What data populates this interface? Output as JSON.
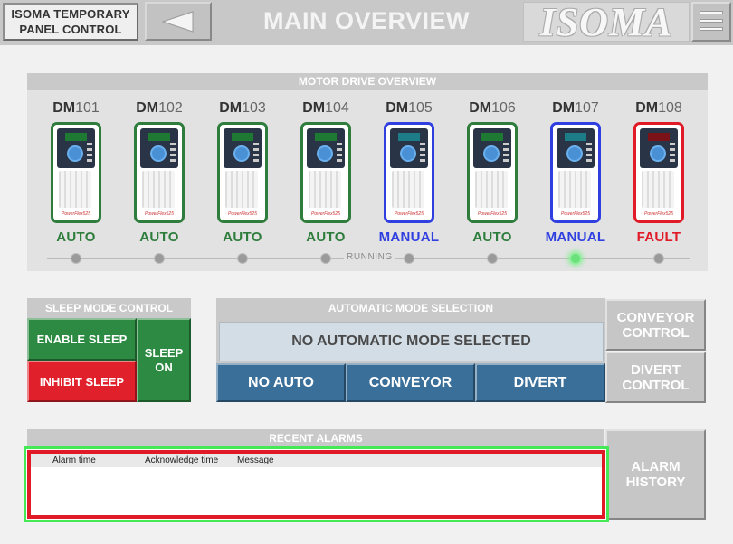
{
  "header": {
    "brand_line1": "ISOMA TEMPORARY",
    "brand_line2": "PANEL CONTROL",
    "title": "MAIN OVERVIEW",
    "logo_text": "ISOMA",
    "back_icon": "left-triangle-icon",
    "menu_icon": "hamburger-menu-icon"
  },
  "motor_panel": {
    "title": "MOTOR DRIVE OVERVIEW",
    "running_label": "RUNNING",
    "drives": [
      {
        "prefix": "DM",
        "num": "101",
        "status": "AUTO",
        "state": "auto",
        "running": false
      },
      {
        "prefix": "DM",
        "num": "102",
        "status": "AUTO",
        "state": "auto",
        "running": false
      },
      {
        "prefix": "DM",
        "num": "103",
        "status": "AUTO",
        "state": "auto",
        "running": false
      },
      {
        "prefix": "DM",
        "num": "104",
        "status": "AUTO",
        "state": "auto",
        "running": false
      },
      {
        "prefix": "DM",
        "num": "105",
        "status": "MANUAL",
        "state": "manual",
        "running": false
      },
      {
        "prefix": "DM",
        "num": "106",
        "status": "AUTO",
        "state": "auto",
        "running": false
      },
      {
        "prefix": "DM",
        "num": "107",
        "status": "MANUAL",
        "state": "manual",
        "running": true
      },
      {
        "prefix": "DM",
        "num": "108",
        "status": "FAULT",
        "state": "fault",
        "running": false
      }
    ],
    "state_colors": {
      "auto": "#2e7d3c",
      "manual": "#2f3fe0",
      "fault": "#e01a26"
    },
    "brand_mark": "PowerFlex525"
  },
  "sleep_panel": {
    "title": "SLEEP MODE CONTROL",
    "enable_label": "ENABLE SLEEP",
    "inhibit_label": "INHIBIT SLEEP",
    "status_line1": "SLEEP",
    "status_line2": "ON"
  },
  "auto_panel": {
    "title": "AUTOMATIC MODE SELECTION",
    "display": "NO AUTOMATIC MODE SELECTED",
    "buttons": [
      "NO AUTO",
      "CONVEYOR",
      "DIVERT"
    ]
  },
  "side_buttons": {
    "conveyor_line1": "CONVEYOR",
    "conveyor_line2": "CONTROL",
    "divert_line1": "DIVERT",
    "divert_line2": "CONTROL",
    "alarm_line1": "ALARM",
    "alarm_line2": "HISTORY"
  },
  "alarms": {
    "title": "RECENT ALARMS",
    "columns": [
      "Alarm time",
      "Acknowledge time",
      "Message"
    ],
    "rows": []
  },
  "colors": {
    "green": "#2d8a43",
    "red": "#e0202a",
    "steel_blue": "#3a6f9a",
    "running_led": "#6ce07a"
  }
}
